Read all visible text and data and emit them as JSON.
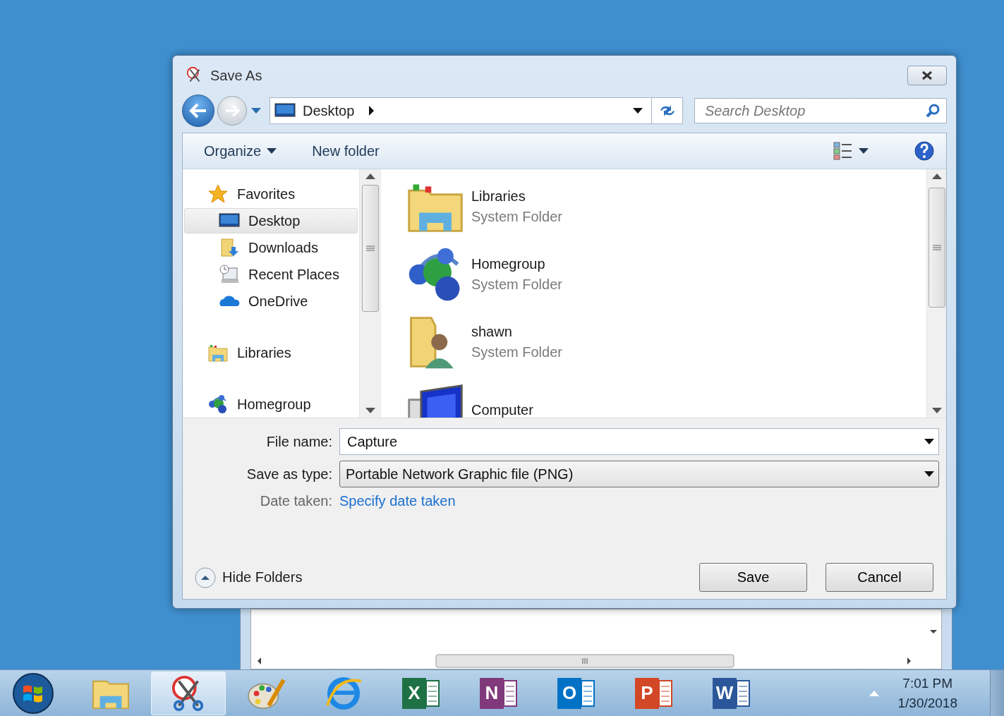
{
  "window": {
    "title": "Save As"
  },
  "address": {
    "location": "Desktop"
  },
  "search": {
    "placeholder": "Search Desktop"
  },
  "toolbar": {
    "organize": "Organize",
    "new_folder": "New folder"
  },
  "nav": [
    {
      "label": "Favorites",
      "kind": "star",
      "selected": false,
      "children": [
        {
          "label": "Desktop",
          "kind": "desktop",
          "selected": true
        },
        {
          "label": "Downloads",
          "kind": "downloads",
          "selected": false
        },
        {
          "label": "Recent Places",
          "kind": "recent",
          "selected": false
        },
        {
          "label": "OneDrive",
          "kind": "onedrive",
          "selected": false
        }
      ]
    },
    {
      "label": "Libraries",
      "kind": "libraries",
      "selected": false
    },
    {
      "label": "Homegroup",
      "kind": "homegroup",
      "selected": false
    }
  ],
  "files": [
    {
      "name": "Libraries",
      "type": "System Folder",
      "kind": "libraries",
      "selected": false
    },
    {
      "name": "Homegroup",
      "type": "System Folder",
      "kind": "homegroup",
      "selected": false
    },
    {
      "name": "shawn",
      "type": "System Folder",
      "kind": "user",
      "selected": false
    },
    {
      "name": "Computer",
      "kind": "computer",
      "selected": false
    }
  ],
  "form": {
    "file_name": {
      "label": "File name:",
      "value": "Capture"
    },
    "save_type": {
      "label": "Save as type:",
      "value": "Portable Network Graphic file (PNG)"
    },
    "date_taken": {
      "label": "Date taken:",
      "link": "Specify date taken"
    }
  },
  "hide_folders": "Hide Folders",
  "buttons": [
    "Save",
    "Cancel"
  ],
  "taskbar": {
    "apps": [
      {
        "kind": "explorer",
        "selected": false
      },
      {
        "kind": "snip",
        "selected": true
      },
      {
        "kind": "paint",
        "selected": false
      },
      {
        "kind": "ie",
        "selected": false
      },
      {
        "kind": "office",
        "letter": "X",
        "color": "#1e7145",
        "selected": false
      },
      {
        "kind": "office",
        "letter": "N",
        "color": "#80397b",
        "selected": false
      },
      {
        "kind": "office",
        "letter": "O",
        "color": "#0072c6",
        "selected": false
      },
      {
        "kind": "office",
        "letter": "P",
        "color": "#d24726",
        "selected": false
      },
      {
        "kind": "office",
        "letter": "W",
        "color": "#2b579a",
        "selected": false
      }
    ],
    "time": "7:01 PM",
    "date": "1/30/2018"
  }
}
